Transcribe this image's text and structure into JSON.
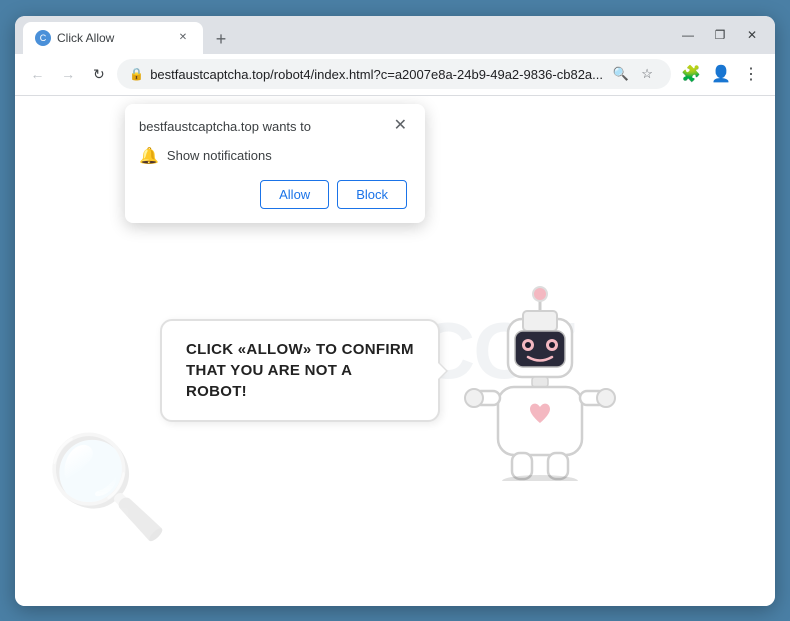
{
  "browser": {
    "tab": {
      "title": "Click Allow",
      "favicon_label": "C"
    },
    "new_tab_icon": "+",
    "window_controls": {
      "minimize": "—",
      "maximize": "❐",
      "close": "✕"
    },
    "nav": {
      "back": "←",
      "forward": "→",
      "refresh": "↻"
    },
    "url": {
      "lock_icon": "🔒",
      "text": "bestfaustcaptcha.top/robot4/index.html?c=a2007e8a-24b9-49a2-9836-cb82a..."
    },
    "toolbar": {
      "search_icon": "🔍",
      "star_icon": "☆",
      "account_icon": "👤",
      "menu_icon": "⋮",
      "extensions_icon": "🧩"
    }
  },
  "notification_popup": {
    "title": "bestfaustcaptcha.top wants to",
    "close_icon": "✕",
    "notification_row": {
      "bell": "🔔",
      "label": "Show notifications"
    },
    "buttons": {
      "allow": "Allow",
      "block": "Block"
    }
  },
  "page": {
    "captcha_text": "CLICK «ALLOW» TO CONFIRM THAT YOU ARE NOT A ROBOT!",
    "watermark": "RISK.CO7"
  }
}
